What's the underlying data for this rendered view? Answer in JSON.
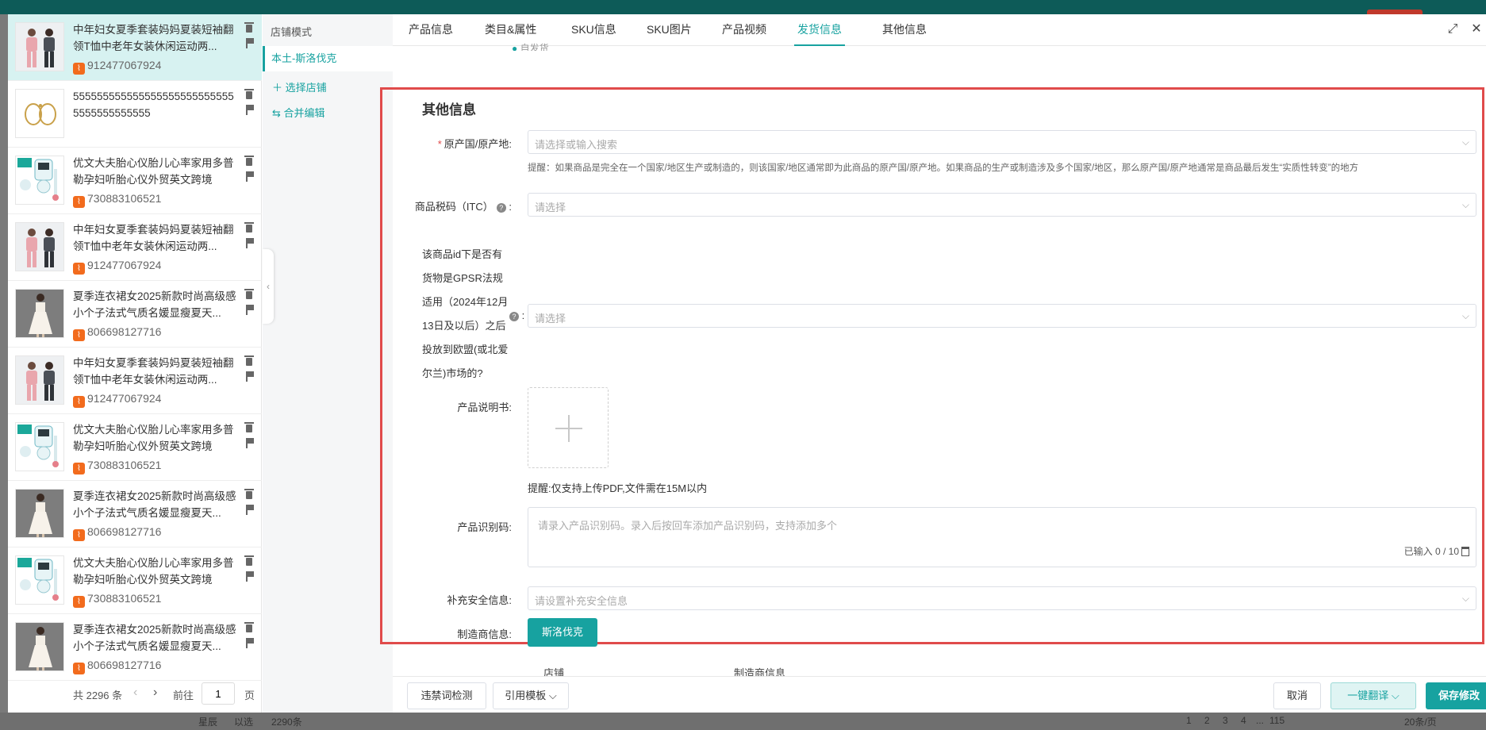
{
  "background": {
    "bottom": {
      "left_text": "星辰",
      "left_text2": "以选",
      "count_text": "2290条",
      "pages": [
        "1",
        "2",
        "3",
        "4",
        "...",
        "115"
      ],
      "page_size": "20条/页"
    }
  },
  "product_list": {
    "items": [
      {
        "title": "中年妇女夏季套装妈妈夏装短袖翻领T恤中老年女装休闲运动两...",
        "id": "912477067924",
        "thumb": "pink-outfit"
      },
      {
        "title": "5555555555555555555555555555555555555555",
        "id": "",
        "thumb": "bracelet"
      },
      {
        "title": "优文大夫胎心仪胎儿心率家用多普勒孕妇听胎心仪外贸英文跨境",
        "id": "730883106521",
        "thumb": "doppler"
      },
      {
        "title": "中年妇女夏季套装妈妈夏装短袖翻领T恤中老年女装休闲运动两...",
        "id": "912477067924",
        "thumb": "pink-outfit"
      },
      {
        "title": "夏季连衣裙女2025新款时尚高级感小个子法式气质名媛显瘦夏天...",
        "id": "806698127716",
        "thumb": "dress"
      },
      {
        "title": "中年妇女夏季套装妈妈夏装短袖翻领T恤中老年女装休闲运动两...",
        "id": "912477067924",
        "thumb": "pink-outfit"
      },
      {
        "title": "优文大夫胎心仪胎儿心率家用多普勒孕妇听胎心仪外贸英文跨境",
        "id": "730883106521",
        "thumb": "doppler"
      },
      {
        "title": "夏季连衣裙女2025新款时尚高级感小个子法式气质名媛显瘦夏天...",
        "id": "806698127716",
        "thumb": "dress"
      },
      {
        "title": "优文大夫胎心仪胎儿心率家用多普勒孕妇听胎心仪外贸英文跨境",
        "id": "730883106521",
        "thumb": "doppler"
      },
      {
        "title": "夏季连衣裙女2025新款时尚高级感小个子法式气质名媛显瘦夏天...",
        "id": "806698127716",
        "thumb": "dress"
      }
    ],
    "pager": {
      "total": "共 2296 条",
      "goto_label": "前往",
      "page_value": "1",
      "page_unit": "页"
    }
  },
  "store_panel": {
    "header": "店铺模式",
    "active_store": "本土-斯洛伐克",
    "select_store": "选择店铺",
    "merge_edit": "合并编辑"
  },
  "tabs": [
    {
      "label": "产品信息",
      "active": false
    },
    {
      "label": "类目&属性",
      "active": false
    },
    {
      "label": "SKU信息",
      "active": false
    },
    {
      "label": "SKU图片",
      "active": false
    },
    {
      "label": "产品视频",
      "active": false
    },
    {
      "label": "发货信息",
      "active": true
    },
    {
      "label": "其他信息",
      "active": false
    }
  ],
  "partial_row_text": "自发货",
  "form": {
    "section_title": "其他信息",
    "origin": {
      "label": "原产国/原产地:",
      "placeholder": "请选择或输入搜索",
      "hint": "提醒：如果商品是完全在一个国家/地区生产或制造的，则该国家/地区通常即为此商品的原产国/原产地。如果商品的生产或制造涉及多个国家/地区，那么原产国/原产地通常是商品最后发生“实质性转变”的地方"
    },
    "itc": {
      "label": "商品税码（ITC）",
      "placeholder": "请选择"
    },
    "gpsr": {
      "label": "该商品id下是否有货物是GPSR法规适用（2024年12月13日及以后）之后投放到欧盟(或北爱尔兰)市场的?",
      "placeholder": "请选择"
    },
    "manual": {
      "label": "产品说明书:",
      "hint": "提醒:仅支持上传PDF,文件需在15M以内"
    },
    "identifier": {
      "label": "产品识别码:",
      "placeholder": "请录入产品识别码。录入后按回车添加产品识别码，支持添加多个",
      "counter": "已输入 0 / 10"
    },
    "safety": {
      "label": "补充安全信息:",
      "placeholder": "请设置补充安全信息"
    },
    "manufacturer": {
      "label": "制造商信息:",
      "store_button": "斯洛伐克"
    },
    "table_headers": [
      "店铺",
      "制造商信息"
    ]
  },
  "footer": {
    "banned_words": "违禁词检测",
    "template": "引用模板",
    "cancel": "取消",
    "translate": "一键翻译",
    "save": "保存修改"
  },
  "colors": {
    "accent": "#17a2a0",
    "highlight_border": "#e04b4b",
    "active_item_bg": "#d7f2f1"
  }
}
